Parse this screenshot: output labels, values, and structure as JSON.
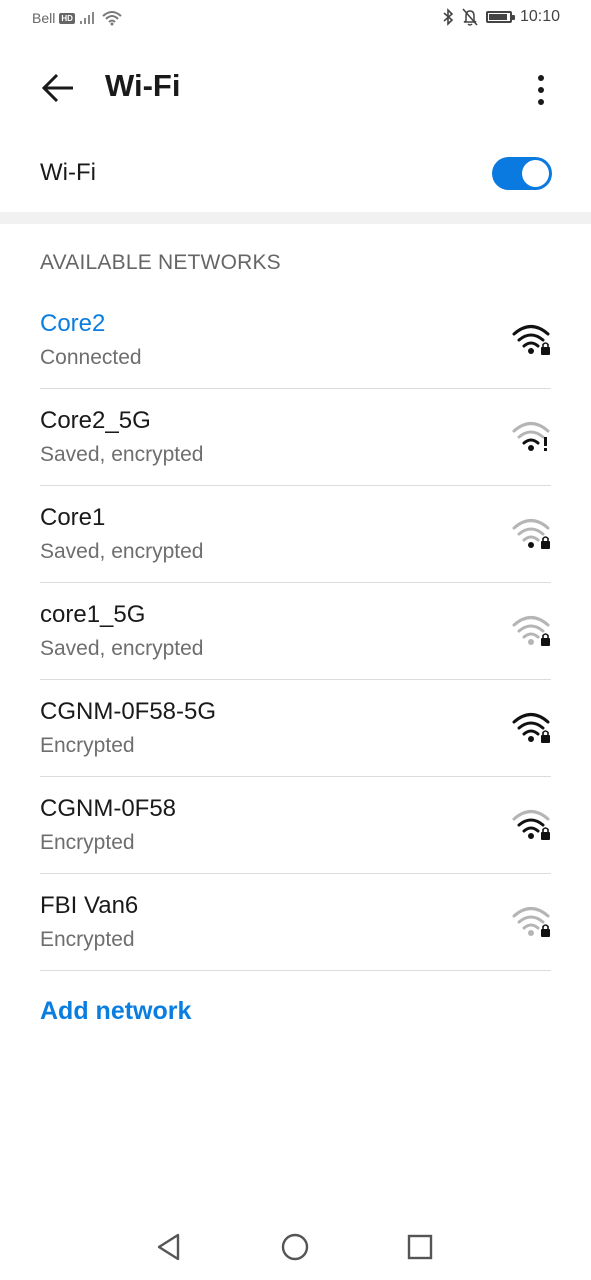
{
  "status_bar": {
    "carrier": "Bell",
    "hd_badge": "HD",
    "time": "10:10",
    "icons": [
      "signal-icon",
      "wifi-status-icon",
      "bluetooth-icon",
      "mute-icon",
      "battery-icon"
    ]
  },
  "header": {
    "title": "Wi-Fi",
    "back_icon": "back-arrow-icon",
    "more_icon": "more-vert-icon"
  },
  "wifi_toggle": {
    "label": "Wi-Fi",
    "enabled": true,
    "accent_color": "#0a79e0"
  },
  "section": {
    "title": "AVAILABLE NETWORKS"
  },
  "networks": [
    {
      "name": "Core2",
      "status": "Connected",
      "connected": true,
      "signal": "strong",
      "icon": "wifi-locked-icon"
    },
    {
      "name": "Core2_5G",
      "status": "Saved, encrypted",
      "connected": false,
      "signal": "weak",
      "icon": "wifi-alert-icon"
    },
    {
      "name": "Core1",
      "status": "Saved, encrypted",
      "connected": false,
      "signal": "weak",
      "icon": "wifi-locked-icon"
    },
    {
      "name": "core1_5G",
      "status": "Saved, encrypted",
      "connected": false,
      "signal": "weak",
      "icon": "wifi-locked-icon"
    },
    {
      "name": "CGNM-0F58-5G",
      "status": "Encrypted",
      "connected": false,
      "signal": "strong",
      "icon": "wifi-locked-icon"
    },
    {
      "name": "CGNM-0F58",
      "status": "Encrypted",
      "connected": false,
      "signal": "strong",
      "icon": "wifi-locked-icon"
    },
    {
      "name": "FBI Van6",
      "status": "Encrypted",
      "connected": false,
      "signal": "weak",
      "icon": "wifi-locked-icon"
    }
  ],
  "add_network": {
    "label": "Add network"
  },
  "nav_bar": {
    "icons": [
      "nav-back-icon",
      "nav-home-icon",
      "nav-recents-icon"
    ]
  },
  "colors": {
    "accent": "#0a7ee0",
    "signal_strong": "#111111",
    "signal_weak": "#b5b5b5"
  }
}
